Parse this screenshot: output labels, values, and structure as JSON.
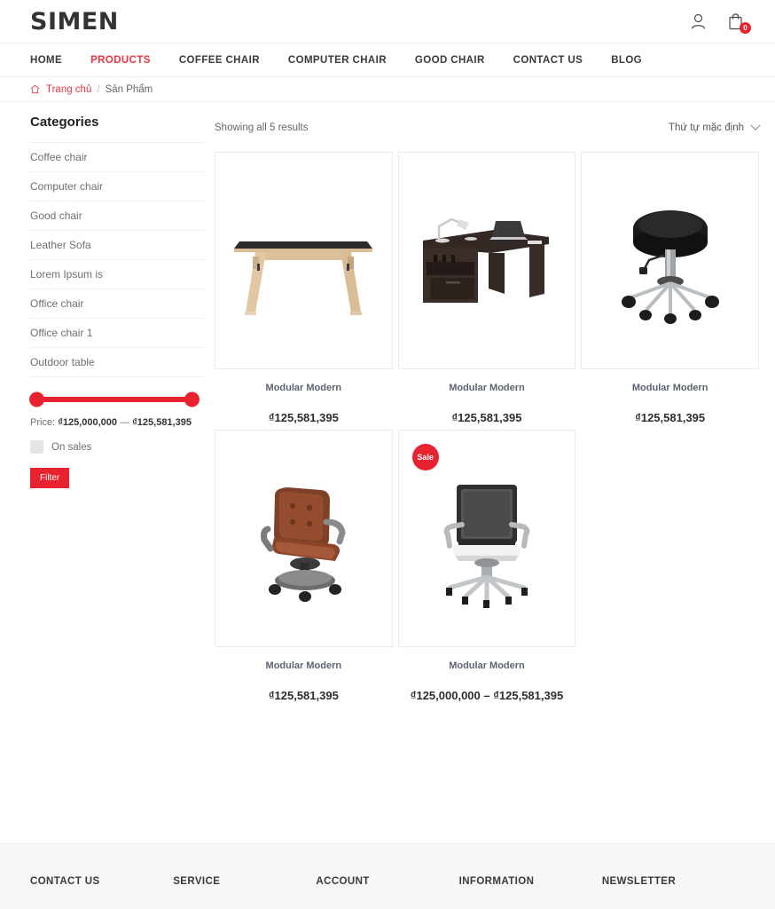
{
  "header": {
    "logo": "SIMEN",
    "account_icon": "user-icon",
    "cart_icon": "shopping-bag-icon",
    "cart_count": "0"
  },
  "nav": {
    "items": [
      {
        "label": "HOME",
        "active": false
      },
      {
        "label": "PRODUCTS",
        "active": true
      },
      {
        "label": "COFFEE CHAIR",
        "active": false
      },
      {
        "label": "COMPUTER CHAIR",
        "active": false
      },
      {
        "label": "GOOD CHAIR",
        "active": false
      },
      {
        "label": "CONTACT US",
        "active": false
      },
      {
        "label": "BLOG",
        "active": false
      }
    ]
  },
  "breadcrumb": {
    "home_icon": "home-icon",
    "home": "Trang chủ",
    "separator": "/",
    "current": "Sản Phẩm"
  },
  "sidebar": {
    "title": "Categories",
    "categories": [
      "Coffee chair",
      "Computer chair",
      "Good chair",
      "Leather Sofa",
      "Lorem Ipsum is",
      "Office chair",
      "Office chair 1",
      "Outdoor table"
    ],
    "price_filter": {
      "prefix": "Price:",
      "min": "₫125,000,000",
      "dash": "—",
      "max": "₫125,581,395",
      "on_sales_label": "On sales",
      "filter_button": "Filter"
    }
  },
  "main": {
    "result_count": "Showing all 5 results",
    "sort_selected": "Thứ tự mặc định",
    "products": [
      {
        "title": "Modular Modern",
        "price": "₫125,581,395",
        "image": "wooden-table-dark-top",
        "sale": false,
        "sale_label": ""
      },
      {
        "title": "Modular Modern",
        "price": "₫125,581,395",
        "image": "espresso-corner-desk",
        "sale": false,
        "sale_label": ""
      },
      {
        "title": "Modular Modern",
        "price": "₫125,581,395",
        "image": "black-rolling-stool",
        "sale": false,
        "sale_label": ""
      },
      {
        "title": "Modular Modern",
        "price": "₫125,581,395",
        "image": "brown-leather-executive-chair",
        "sale": false,
        "sale_label": ""
      },
      {
        "title": "Modular Modern",
        "price": "₫125,000,000 – ₫125,581,395",
        "image": "black-mesh-office-chair",
        "sale": true,
        "sale_label": "Sale"
      }
    ]
  },
  "footer": {
    "columns": [
      "CONTACT US",
      "SERVICE",
      "ACCOUNT",
      "INFORMATION",
      "NEWSLETTER"
    ]
  },
  "colors": {
    "accent": "#ef3340",
    "accent_solid": "#e8222e",
    "text": "#3a3a3a",
    "muted": "#6f6f6f",
    "card_border": "#ececec",
    "footer_bg": "#f7f7f7"
  }
}
